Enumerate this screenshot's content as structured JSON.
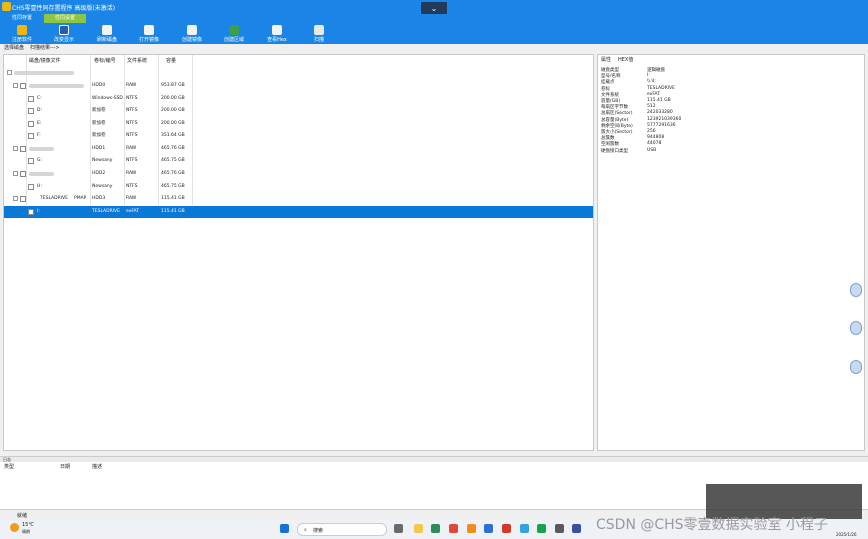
{
  "window": {
    "title": "CHS零壹性同存置程序 高级版(未激活)",
    "collapse_glyph": "⌄"
  },
  "tabs": [
    {
      "label": "性同存置"
    },
    {
      "label": "性同设置"
    }
  ],
  "toolbar": [
    {
      "label": "注册软件",
      "icon": "register-icon",
      "color": "#f2b70f"
    },
    {
      "label": "改变显示",
      "icon": "display-icon",
      "color": "#2a5caa"
    },
    {
      "label": "刷新磁盘",
      "icon": "refresh-icon",
      "color": "#f3f3f3"
    },
    {
      "label": "打开镜像",
      "icon": "open-image-icon",
      "color": "#f3f3f3"
    },
    {
      "label": "创建镜像",
      "icon": "create-image-icon",
      "color": "#f3f3f3"
    },
    {
      "label": "创建区域",
      "icon": "create-region-icon",
      "color": "#3aa04a"
    },
    {
      "label": "查看Hex",
      "icon": "hex-icon",
      "color": "#f3f3f3"
    },
    {
      "label": "扫描",
      "icon": "scan-icon",
      "color": "#e8e8e8"
    }
  ],
  "breadcrumb": {
    "label1": "选择磁盘",
    "label2": "扫描结果--->"
  },
  "disk_table": {
    "columns": [
      "磁盘/镜像文件",
      "卷标/编号",
      "文件系统",
      "容量"
    ],
    "rows": [
      {
        "name": "",
        "id": "HDD0",
        "fs": "RAW",
        "size": "953.87 GB"
      },
      {
        "name": "C:",
        "id": "Windows-SSD",
        "fs": "NTFS",
        "size": "200.00 GB"
      },
      {
        "name": "D:",
        "id": "新加卷",
        "fs": "NTFS",
        "size": "200.00 GB"
      },
      {
        "name": "E:",
        "id": "新加卷",
        "fs": "NTFS",
        "size": "200.00 GB"
      },
      {
        "name": "F:",
        "id": "新加卷",
        "fs": "NTFS",
        "size": "351.64 GB"
      },
      {
        "name": "",
        "id": "HDD1",
        "fs": "RAW",
        "size": "465.76 GB"
      },
      {
        "name": "G:",
        "id": "Newsany",
        "fs": "NTFS",
        "size": "465.75 GB"
      },
      {
        "name": "",
        "id": "HDD2",
        "fs": "RAW",
        "size": "465.76 GB"
      },
      {
        "name": "H:",
        "id": "Newsany",
        "fs": "NTFS",
        "size": "465.75 GB"
      },
      {
        "name": "TESLADRIVE",
        "extra": "PMAP",
        "id": "HDD3",
        "fs": "RAW",
        "size": "115.41 GB"
      },
      {
        "name": "I:",
        "id": "TESLADRIVE",
        "fs": "exFAT",
        "size": "115.41 GB"
      }
    ]
  },
  "properties": {
    "tabs": [
      "属性",
      "HEX值"
    ],
    "rows": [
      {
        "k": "磁盘类型",
        "v": "逻辑磁盘"
      },
      {
        "k": "型号/名称",
        "v": "I:"
      },
      {
        "k": "挂载点",
        "v": "\\\\.\\I:"
      },
      {
        "k": "卷标",
        "v": "TESLADRIVE"
      },
      {
        "k": "文件系统",
        "v": "exFAT"
      },
      {
        "k": "容量(GB)",
        "v": "115.41 GB"
      },
      {
        "k": "每扇区字节数",
        "v": "512"
      },
      {
        "k": "总扇区(Sector)",
        "v": "242033280"
      },
      {
        "k": "总容量(Byte)",
        "v": "123921039360"
      },
      {
        "k": "剩余空间(Byte)",
        "v": "5777291636"
      },
      {
        "k": "簇大小(Sector)",
        "v": "256"
      },
      {
        "k": "总簇数",
        "v": "944808"
      },
      {
        "k": "空闲簇数",
        "v": "44078"
      },
      {
        "k": "硬盘接口类型",
        "v": "USB"
      }
    ]
  },
  "log": {
    "bar_label": "日志",
    "columns": [
      "类型",
      "日期",
      "描述"
    ]
  },
  "status": {
    "text": "就绪"
  },
  "taskbar": {
    "weather_temp": "15℃",
    "weather_desc": "晴朗",
    "search_placeholder": "搜索",
    "date": "2025/1/26"
  },
  "watermark": "CSDN @CHS零壹数据实验室 小程子"
}
